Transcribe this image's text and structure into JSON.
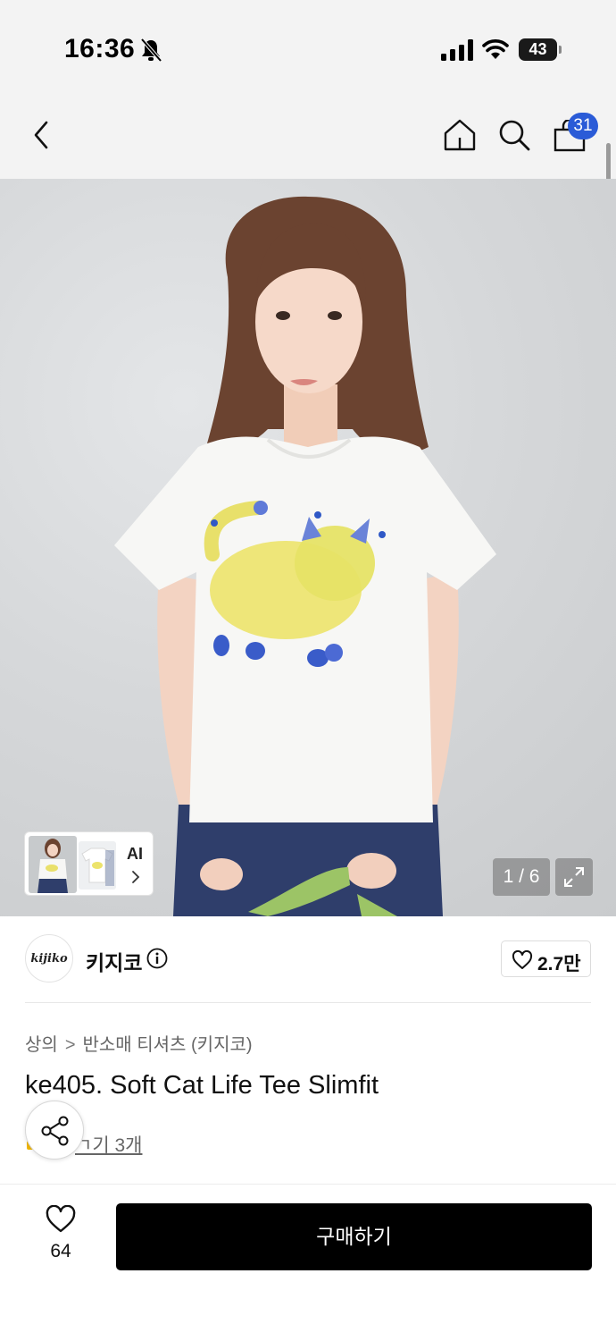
{
  "status_bar": {
    "time": "16:36",
    "battery": "43"
  },
  "nav": {
    "cart_count": "31"
  },
  "gallery": {
    "ai_label": "AI",
    "page_counter": "1 / 6"
  },
  "brand": {
    "logo_text": "kijiko",
    "name": "키지코",
    "likes": "2.7만"
  },
  "product": {
    "breadcrumb": [
      "상의",
      "반소매 티셔츠 (키지코)"
    ],
    "breadcrumb_separator": ">",
    "title": "ke405. Soft Cat Life Tee Slimfit",
    "review_link": "후기 3개",
    "review_link_visible": "ㄱ기 3개"
  },
  "bottom_bar": {
    "wish_count": "64",
    "buy_label": "구매하기"
  },
  "colors": {
    "accent_badge": "#2a5bd7",
    "buy_button": "#000000"
  },
  "icons": [
    "bell-off-icon",
    "signal-icon",
    "wifi-icon",
    "battery-icon",
    "back-icon",
    "home-icon",
    "search-icon",
    "bag-icon",
    "chevron-right-icon",
    "expand-icon",
    "info-icon",
    "heart-icon",
    "share-icon"
  ]
}
